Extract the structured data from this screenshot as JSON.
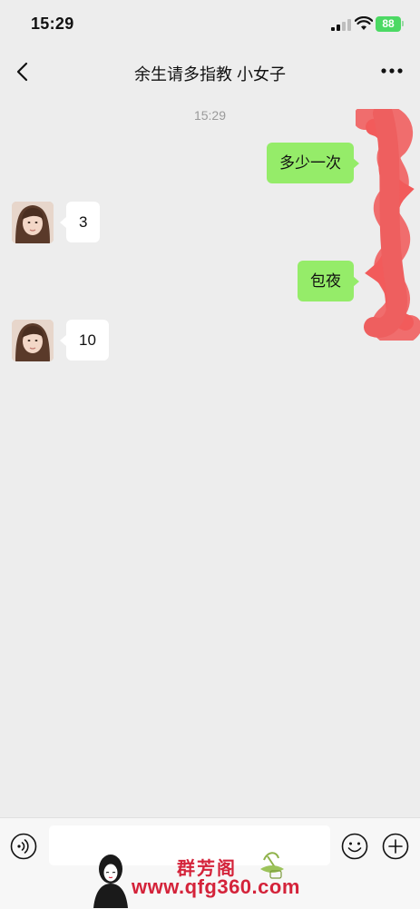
{
  "status_bar": {
    "time": "15:29",
    "battery": "88"
  },
  "chat": {
    "title": "余生请多指教  小女子"
  },
  "messages": {
    "timestamp": "15:29",
    "items": [
      {
        "side": "out",
        "text": "多少一次"
      },
      {
        "side": "in",
        "text": "3"
      },
      {
        "side": "out",
        "text": "包夜"
      },
      {
        "side": "in",
        "text": "10"
      }
    ]
  },
  "input": {
    "placeholder": ""
  },
  "watermark": {
    "brand": "群芳阁",
    "url": "www.qfg360.com"
  },
  "colors": {
    "outgoing_bubble": "#95ec69",
    "incoming_bubble": "#ffffff",
    "background": "#ededed",
    "watermark": "#d4233a"
  },
  "icons": [
    "back-arrow-icon",
    "more-dots-icon",
    "voice-icon",
    "emoji-icon",
    "plus-icon",
    "signal-icon",
    "wifi-icon",
    "battery-icon"
  ]
}
